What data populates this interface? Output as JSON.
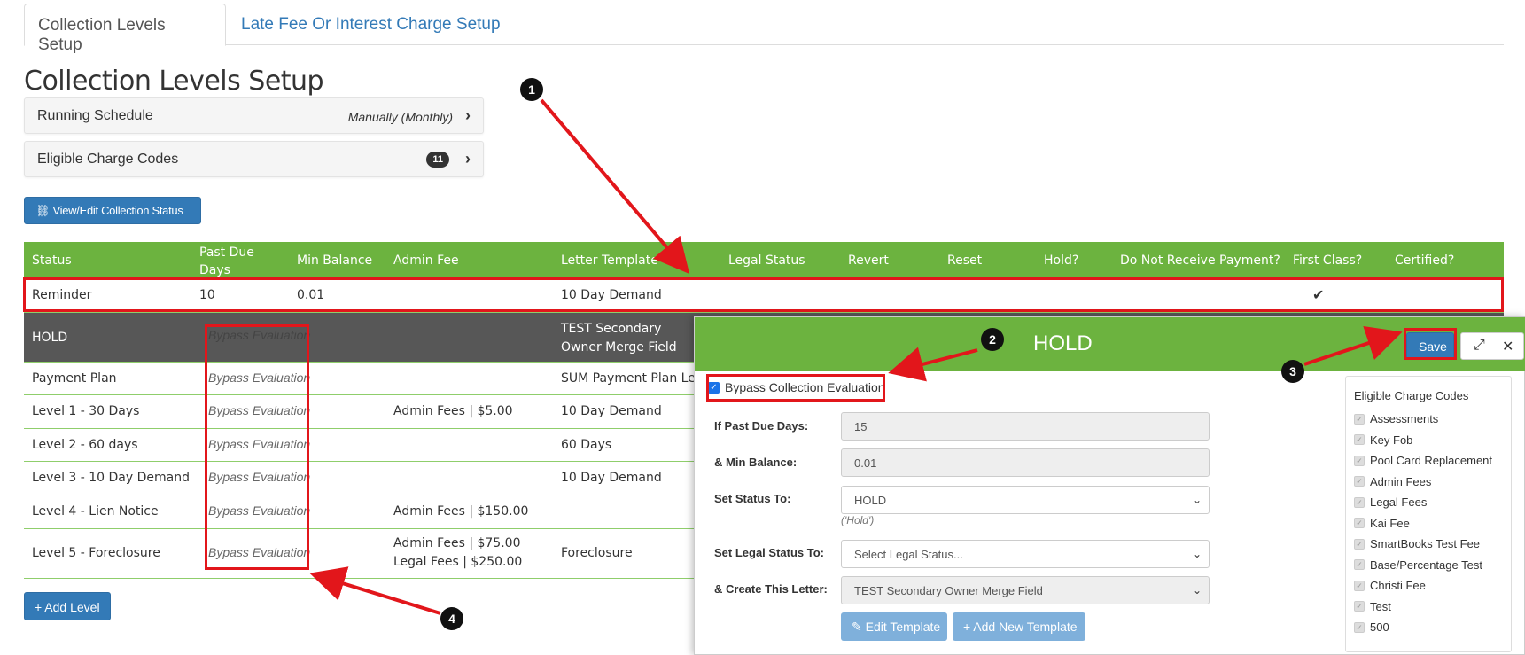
{
  "tabs": [
    "Collection Levels Setup",
    "Late Fee Or Interest Charge Setup"
  ],
  "page_title": "Collection Levels Setup",
  "running_schedule": {
    "label": "Running Schedule",
    "value": "Manually (Monthly)"
  },
  "eligible_codes_row": {
    "label": "Eligible Charge Codes",
    "count": "11"
  },
  "view_button": "View/Edit Collection Status",
  "add_level_button": "+ Add Level",
  "table": {
    "headers": [
      "Status",
      "Past Due Days",
      "Min Balance",
      "Admin Fee",
      "Letter Template",
      "Legal Status",
      "Revert",
      "Reset",
      "Hold?",
      "Do Not Receive Payment?",
      "First Class?",
      "Certified?"
    ],
    "rows": [
      {
        "status": "Reminder",
        "past_due": "10",
        "min_balance": "0.01",
        "admin_fee": "",
        "letter": "10 Day Demand",
        "first_class": "✔"
      },
      {
        "status": "HOLD",
        "past_due": "Bypass Evaluation",
        "admin_fee": "",
        "letter": "TEST Secondary Owner Merge Field"
      },
      {
        "status": "Payment Plan",
        "past_due": "Bypass Evaluation",
        "admin_fee": "",
        "letter": "SUM Payment Plan Let"
      },
      {
        "status": "Level 1 - 30 Days",
        "past_due": "Bypass Evaluation",
        "admin_fee": "Admin Fees | $5.00",
        "letter": "10 Day Demand"
      },
      {
        "status": "Level 2 - 60 days",
        "past_due": "Bypass Evaluation",
        "admin_fee": "",
        "letter": "60 Days"
      },
      {
        "status": "Level 3 - 10 Day Demand",
        "past_due": "Bypass Evaluation",
        "admin_fee": "",
        "letter": "10 Day Demand"
      },
      {
        "status": "Level 4 - Lien Notice",
        "past_due": "Bypass Evaluation",
        "admin_fee": "Admin Fees | $150.00",
        "letter": ""
      },
      {
        "status": "Level 5 - Foreclosure",
        "past_due": "Bypass Evaluation",
        "admin_fee": "Admin Fees | $75.00",
        "admin_fee2": "Legal Fees | $250.00",
        "letter": "Foreclosure"
      }
    ]
  },
  "modal": {
    "title": "HOLD",
    "save": "Save",
    "bypass_label": "Bypass Collection Evaluation",
    "fields": {
      "past_due_label": "If Past Due Days:",
      "past_due_value": "15",
      "min_balance_label": "& Min Balance:",
      "min_balance_value": "0.01",
      "status_label": "Set Status To:",
      "status_value": "HOLD",
      "status_hint": "('Hold')",
      "legal_label": "Set Legal Status To:",
      "legal_value": "Select Legal Status...",
      "letter_label": "& Create This Letter:",
      "letter_value": "TEST Secondary Owner Merge Field"
    },
    "edit_template": "Edit Template",
    "add_template": "+ Add New Template",
    "eligible_header": "Eligible Charge Codes",
    "eligible_codes": [
      "Assessments",
      "Key Fob",
      "Pool Card Replacement",
      "Admin Fees",
      "Legal Fees",
      "Kai Fee",
      "SmartBooks Test Fee",
      "Base/Percentage Test",
      "Christi Fee",
      "Test",
      "500"
    ]
  },
  "markers": [
    "1",
    "2",
    "3",
    "4"
  ],
  "colors": {
    "green": "#6cb33f",
    "blue": "#337ab7",
    "red": "#e2161b",
    "dark_row": "#575757"
  }
}
